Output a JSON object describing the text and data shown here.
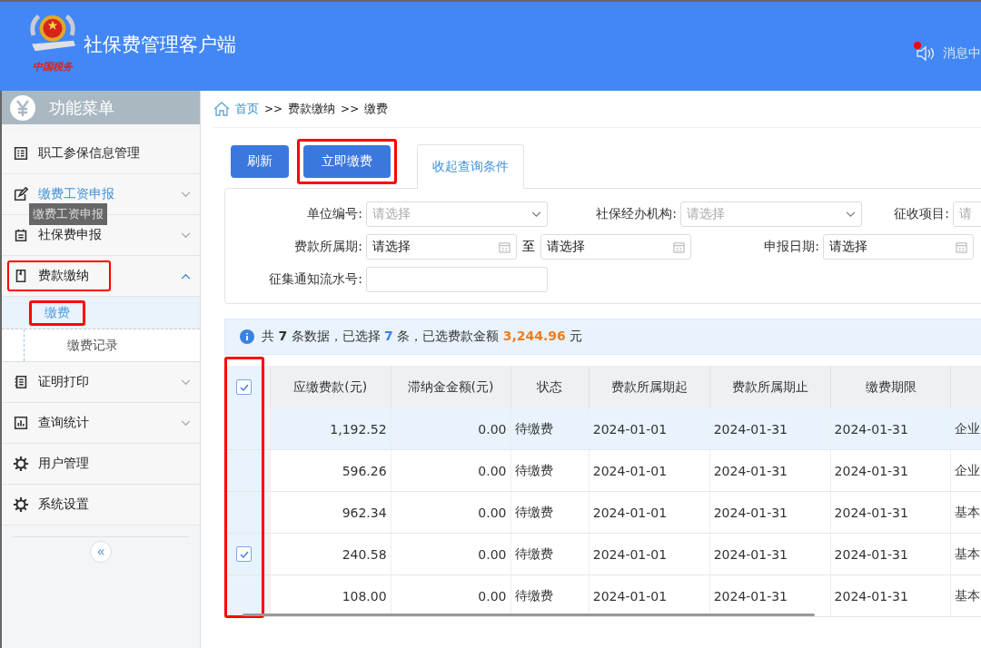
{
  "header": {
    "title": "社保费管理客户端",
    "logo_caption": "中国税务",
    "message_center": {
      "label": "消息中",
      "unread": true
    }
  },
  "sidebar": {
    "title": "功能菜单",
    "tooltip": "缴费工资申报",
    "collapse_label": "«",
    "items": [
      {
        "label": "职工参保信息管理",
        "active": false,
        "highlighted": false
      },
      {
        "label": "缴费工资申报",
        "active": true,
        "expanded": false,
        "highlighted": false
      },
      {
        "label": "社保费申报",
        "active": false,
        "expanded": false,
        "highlighted": false
      },
      {
        "label": "费款缴纳",
        "active": false,
        "expanded": true,
        "highlighted": true,
        "children": [
          {
            "label": "缴费",
            "selected": true,
            "highlighted": true
          },
          {
            "label": "缴费记录",
            "selected": false,
            "highlighted": false
          }
        ]
      },
      {
        "label": "证明打印",
        "active": false,
        "expanded": false,
        "highlighted": false
      },
      {
        "label": "查询统计",
        "active": false,
        "expanded": false,
        "highlighted": false
      },
      {
        "label": "用户管理",
        "active": false,
        "highlighted": false
      },
      {
        "label": "系统设置",
        "active": false,
        "highlighted": false
      }
    ]
  },
  "breadcrumb": {
    "separator": ">>",
    "items": [
      "首页",
      "费款缴纳",
      "缴费"
    ]
  },
  "toolbar": {
    "buttons": [
      {
        "label": "刷新",
        "highlighted": false
      },
      {
        "label": "立即缴费",
        "highlighted": true
      }
    ],
    "tab": {
      "label": "收起查询条件"
    }
  },
  "filters": [
    [
      {
        "kind": "select",
        "label": "单位编号:",
        "placeholder": "请选择"
      },
      {
        "kind": "select",
        "label": "社保经办机构:",
        "placeholder": "请选择"
      },
      {
        "kind": "select",
        "label": "征收项目:",
        "placeholder": "请"
      }
    ],
    [
      {
        "kind": "range",
        "label": "费款所属期:",
        "value": "请选择",
        "joiner": "至",
        "value_2": "请选择"
      },
      {
        "kind": "date",
        "label": "申报日期:",
        "value": "请选择"
      }
    ],
    [
      {
        "kind": "text",
        "label": "征集通知流水号:"
      }
    ]
  ],
  "summary": {
    "text_1": "共",
    "total": "7",
    "text_2": "条数据，已选择",
    "selected": "7",
    "text_3": "条，已选费款金额",
    "amount": "3,244.96",
    "text_4": "元"
  },
  "table": {
    "all_checked": true,
    "highlighted": true,
    "columns": [
      "应缴费款(元)",
      "滞纳金金额(元)",
      "状态",
      "费款所属期起",
      "费款所属期止",
      "缴费期限"
    ],
    "rows": [
      {
        "checked": false,
        "selected": true,
        "cells": [
          "1,192.52",
          "0.00",
          "待缴费",
          "2024-01-01",
          "2024-01-31",
          "2024-01-31",
          "企业"
        ]
      },
      {
        "checked": false,
        "selected": false,
        "cells": [
          "596.26",
          "0.00",
          "待缴费",
          "2024-01-01",
          "2024-01-31",
          "2024-01-31",
          "企业"
        ]
      },
      {
        "checked": false,
        "selected": false,
        "cells": [
          "962.34",
          "0.00",
          "待缴费",
          "2024-01-01",
          "2024-01-31",
          "2024-01-31",
          "基本"
        ]
      },
      {
        "checked": true,
        "selected": false,
        "cells": [
          "240.58",
          "0.00",
          "待缴费",
          "2024-01-01",
          "2024-01-31",
          "2024-01-31",
          "基本"
        ]
      },
      {
        "checked": false,
        "selected": false,
        "cells": [
          "108.00",
          "0.00",
          "待缴费",
          "2024-01-01",
          "2024-01-31",
          "2024-01-31",
          "基本"
        ]
      }
    ]
  }
}
